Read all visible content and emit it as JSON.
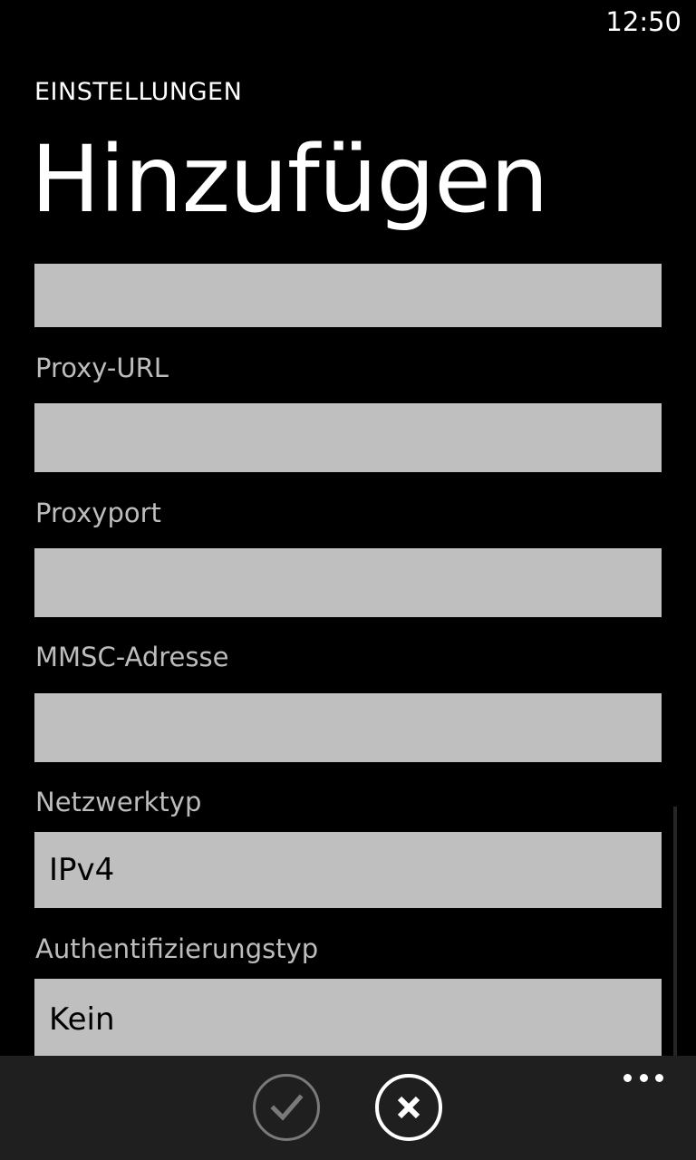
{
  "status_bar": {
    "time": "12:50"
  },
  "header": {
    "app_title": "EINSTELLUNGEN",
    "page_title": "Hinzufügen"
  },
  "form": {
    "fields": [
      {
        "label": "",
        "value": ""
      },
      {
        "label": "Proxy-URL",
        "value": ""
      },
      {
        "label": "Proxyport",
        "value": ""
      },
      {
        "label": "MMSC-Adresse",
        "value": ""
      },
      {
        "label": "Netzwerktyp",
        "value": "IPv4"
      },
      {
        "label": "Authentifizierungstyp",
        "value": "Kein"
      }
    ]
  },
  "app_bar": {
    "save_icon": "checkmark-icon",
    "cancel_icon": "close-icon",
    "more_icon": "more-dots-icon"
  },
  "colors": {
    "background": "#000000",
    "field_background": "#bfbfbf",
    "label_text": "#bdbdbd",
    "app_bar_background": "#1f1f1f",
    "disabled_button": "#7a7a7a"
  }
}
